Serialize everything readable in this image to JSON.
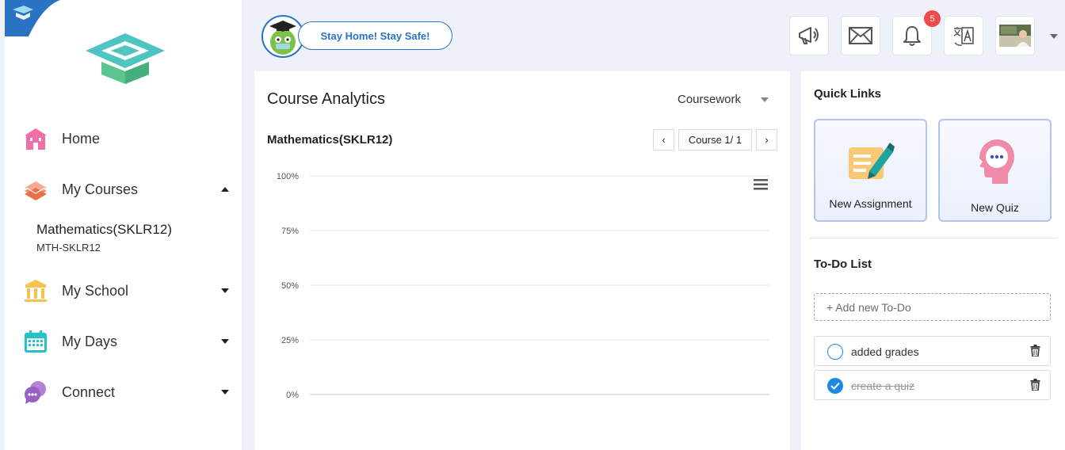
{
  "sidebar": {
    "nav": [
      {
        "label": "Home",
        "icon": "home-icon"
      },
      {
        "label": "My Courses",
        "icon": "books-icon",
        "expanded": true
      },
      {
        "label": "My School",
        "icon": "school-icon"
      },
      {
        "label": "My Days",
        "icon": "calendar-icon"
      },
      {
        "label": "Connect",
        "icon": "chat-icon"
      }
    ],
    "course": {
      "title": "Mathematics(SKLR12)",
      "code": "MTH-SKLR12"
    }
  },
  "header": {
    "banner": "Stay Home! Stay Safe!",
    "notification_count": "5",
    "icons": [
      "megaphone-icon",
      "mail-icon",
      "bell-icon",
      "translate-icon",
      "avatar"
    ]
  },
  "analytics": {
    "title": "Course Analytics",
    "filter": "Coursework",
    "course_name": "Mathematics(SKLR12)",
    "pager": {
      "prev": "‹",
      "label": "Course 1/ 1",
      "next": "›"
    }
  },
  "chart_data": {
    "type": "bar",
    "title": "",
    "xlabel": "",
    "ylabel": "",
    "categories": [],
    "values": [],
    "ylim": [
      0,
      100
    ],
    "yticks": [
      "100%",
      "75%",
      "50%",
      "25%",
      "0%"
    ],
    "grid": true
  },
  "quick_links": {
    "title": "Quick Links",
    "items": [
      {
        "label": "New Assignment",
        "icon": "assignment-icon"
      },
      {
        "label": "New Quiz",
        "icon": "quiz-icon"
      }
    ]
  },
  "todo": {
    "title": "To-Do List",
    "placeholder": "+ Add new To-Do",
    "items": [
      {
        "text": "added grades",
        "done": false
      },
      {
        "text": "create a quiz",
        "done": true
      }
    ]
  },
  "colors": {
    "accent": "#2a73c4",
    "badge": "#ef4b4b",
    "logo": "#4ec5c1",
    "check": "#1e88e5"
  }
}
